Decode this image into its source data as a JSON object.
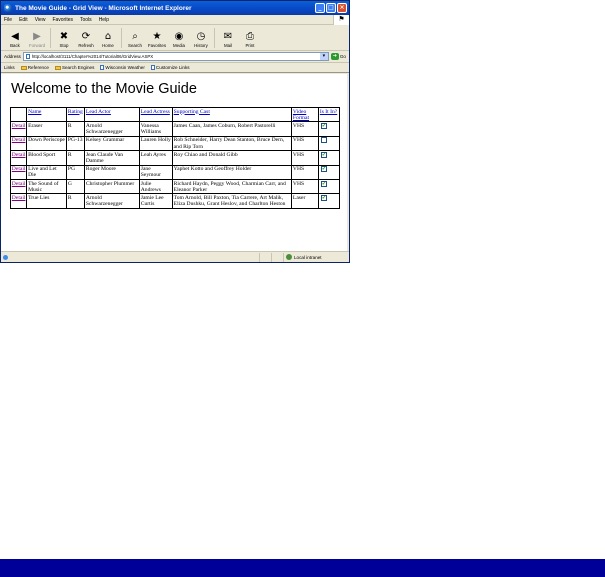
{
  "window": {
    "title": "The Movie Guide - Grid View - Microsoft Internet Explorer",
    "controls": {
      "minimize": "_",
      "maximize": "□",
      "close": "×"
    }
  },
  "menu": [
    "File",
    "Edit",
    "View",
    "Favorites",
    "Tools",
    "Help"
  ],
  "toolbar": [
    {
      "label": "Back",
      "icon": "back-arrow-icon",
      "glyph": "◀",
      "has_caret": true
    },
    {
      "label": "Forward",
      "icon": "forward-arrow-icon",
      "glyph": "▶",
      "disabled": true,
      "has_caret": true
    },
    {
      "label": "Stop",
      "icon": "stop-icon",
      "glyph": "✖"
    },
    {
      "label": "Refresh",
      "icon": "refresh-icon",
      "glyph": "⟳"
    },
    {
      "label": "Home",
      "icon": "home-icon",
      "glyph": "⌂"
    },
    {
      "label": "Search",
      "icon": "search-icon",
      "glyph": "⌕"
    },
    {
      "label": "Favorites",
      "icon": "favorites-star-icon",
      "glyph": "★"
    },
    {
      "label": "Media",
      "icon": "media-icon",
      "glyph": "◉"
    },
    {
      "label": "History",
      "icon": "history-icon",
      "glyph": "◷"
    },
    {
      "label": "Mail",
      "icon": "mail-icon",
      "glyph": "✉",
      "has_caret": true
    },
    {
      "label": "Print",
      "icon": "print-icon",
      "glyph": "⎙"
    }
  ],
  "address": {
    "label": "Address",
    "url": "http://localhost/3111/Chapter%2014/Tutorial06/GridView.ASPX",
    "go_label": "Go"
  },
  "links": {
    "label": "Links",
    "items": [
      {
        "label": "Reference",
        "icon": "folder-icon"
      },
      {
        "label": "Search Engines",
        "icon": "folder-icon"
      },
      {
        "label": "Wisconsin Weather",
        "icon": "page-icon"
      },
      {
        "label": "Customize Links",
        "icon": "page-icon"
      }
    ]
  },
  "page": {
    "heading": "Welcome to the Movie Guide",
    "columns": [
      "",
      "Name",
      "Rating",
      "Lead Actor",
      "Lead Actress",
      "Supporting Cast",
      "Video Format",
      "Is It In?"
    ],
    "rows": [
      {
        "link": "Detail",
        "name": "Eraser",
        "rating": "R",
        "actor": "Arnold Schwarzenegger",
        "actress": "Vanessa Williams",
        "cast": "James Caan, James Coburn, Robert Pastorelli",
        "format": "VHS",
        "in": true
      },
      {
        "link": "Detail",
        "name": "Down Periscope",
        "rating": "PG-13",
        "actor": "Kelsey Grammar",
        "actress": "Lauren Holly",
        "cast": "Rob Schneider, Harry Dean Stanton, Bruce Dern, and Rip Torn",
        "format": "VHS",
        "in": false
      },
      {
        "link": "Detail",
        "name": "Blood Sport",
        "rating": "R",
        "actor": "Jean Claude Van Damme",
        "actress": "Leah Ayres",
        "cast": "Roy Chiao and Donald Gibb",
        "format": "VHS",
        "in": true
      },
      {
        "link": "Detail",
        "name": "Live and Let Die",
        "rating": "PG",
        "actor": "Roger Moore",
        "actress": "Jane Seymour",
        "cast": "Yaphet Kotto and Geoffrey Holder",
        "format": "VHS",
        "in": true
      },
      {
        "link": "Detail",
        "name": "The Sound of Music",
        "rating": "G",
        "actor": "Christopher Plummer",
        "actress": "Julie Andrews",
        "cast": "Richard Haydn, Peggy Wood, Charmian Carr, and Eleanor Parker",
        "format": "VHS",
        "in": true
      },
      {
        "link": "Detail",
        "name": "True Lies",
        "rating": "R",
        "actor": "Arnold Schwarzenegger",
        "actress": "Jamie Lee Curtis",
        "cast": "Tom Arnold, Bill Paxton, Tia Carrere, Art Malik, Eliza Dushku, Grant Heslov, and Charlton Heston",
        "format": "Laser",
        "in": true
      }
    ]
  },
  "status": {
    "zone": "Local intranet"
  },
  "colors": {
    "title_bar": "#0846c4",
    "bottom_band": "#000099",
    "link": "#0000cc",
    "visited_link": "#800080"
  }
}
